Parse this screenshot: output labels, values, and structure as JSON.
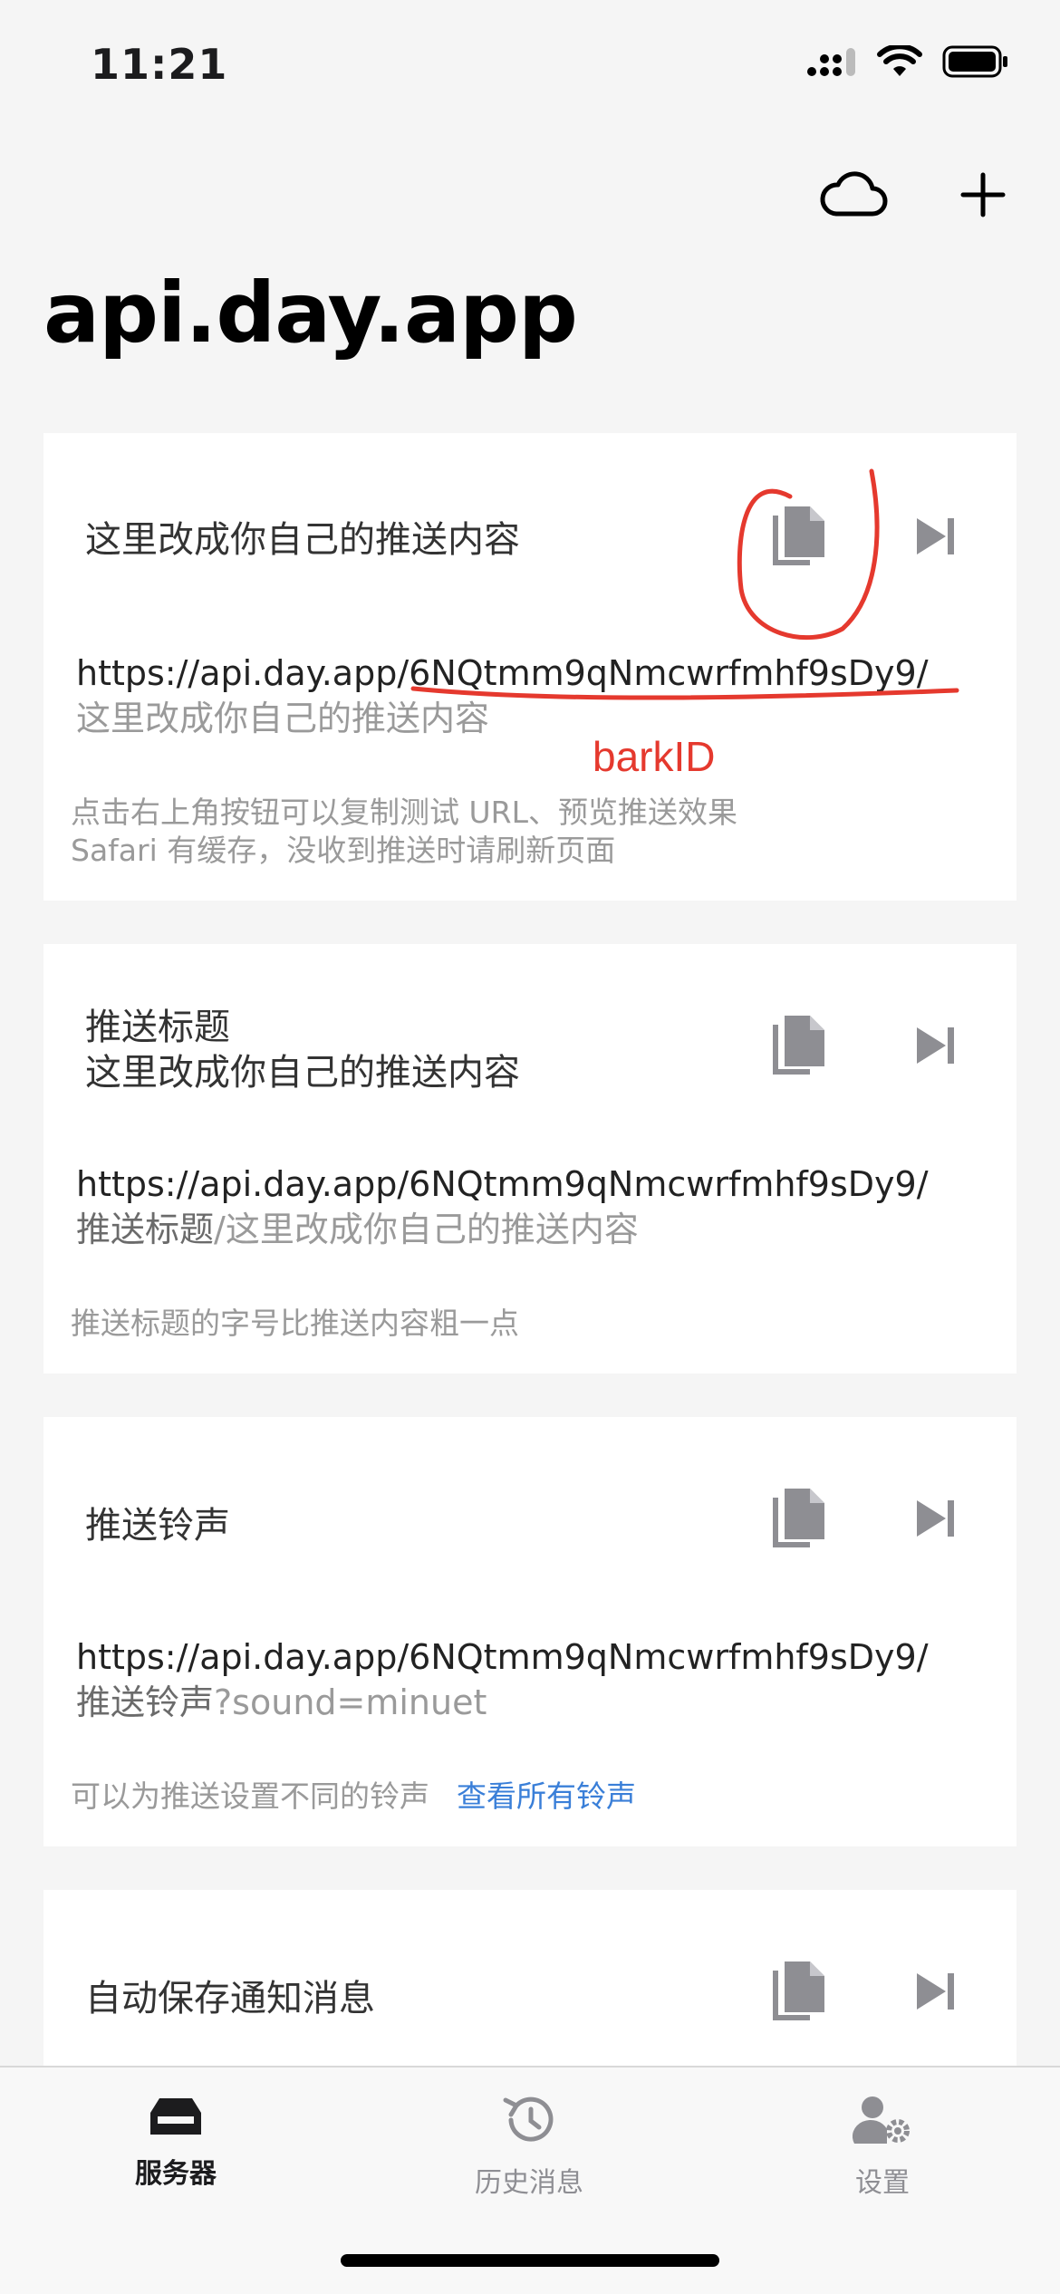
{
  "status": {
    "time": "11:21"
  },
  "nav": {
    "title": "api.day.app"
  },
  "cards": [
    {
      "title_line1": "这里改成你自己的推送内容",
      "title_line2": "",
      "url_base": "https://api.day.app/",
      "url_key": "6NQtmm9qNmcwrfmhf9sDy9",
      "url_slash": "/",
      "url_sub_dark": "",
      "url_sub_light": "这里改成你自己的推送内容",
      "hint_line1": "点击右上角按钮可以复制测试 URL、预览推送效果",
      "hint_line2": "Safari 有缓存，没收到推送时请刷新页面"
    },
    {
      "title_line1": "推送标题",
      "title_line2": "这里改成你自己的推送内容",
      "url_base": "https://api.day.app/",
      "url_key": "6NQtmm9qNmcwrfmhf9sDy9",
      "url_slash": "/",
      "url_sub_dark": "推送标题",
      "url_sub_light": "/这里改成你自己的推送内容",
      "hint_line1": "推送标题的字号比推送内容粗一点",
      "hint_line2": ""
    },
    {
      "title_line1": "推送铃声",
      "title_line2": "",
      "url_base": "https://api.day.app/",
      "url_key": "6NQtmm9qNmcwrfmhf9sDy9",
      "url_slash": "/",
      "url_sub_dark": "推送铃声",
      "url_sub_light": "?sound=minuet",
      "hint_line1": "可以为推送设置不同的铃声",
      "hint_link": "查看所有铃声"
    },
    {
      "title_line1": "自动保存通知消息"
    }
  ],
  "annotation": {
    "label": "barkID",
    "color": "#e5392e"
  },
  "tabbar": {
    "tabs": [
      {
        "label": "服务器",
        "icon": "server-icon",
        "active": true
      },
      {
        "label": "历史消息",
        "icon": "history-icon",
        "active": false
      },
      {
        "label": "设置",
        "icon": "settings-icon",
        "active": false
      }
    ]
  },
  "colors": {
    "link": "#3a7fd8",
    "annotation": "#e5392e"
  }
}
